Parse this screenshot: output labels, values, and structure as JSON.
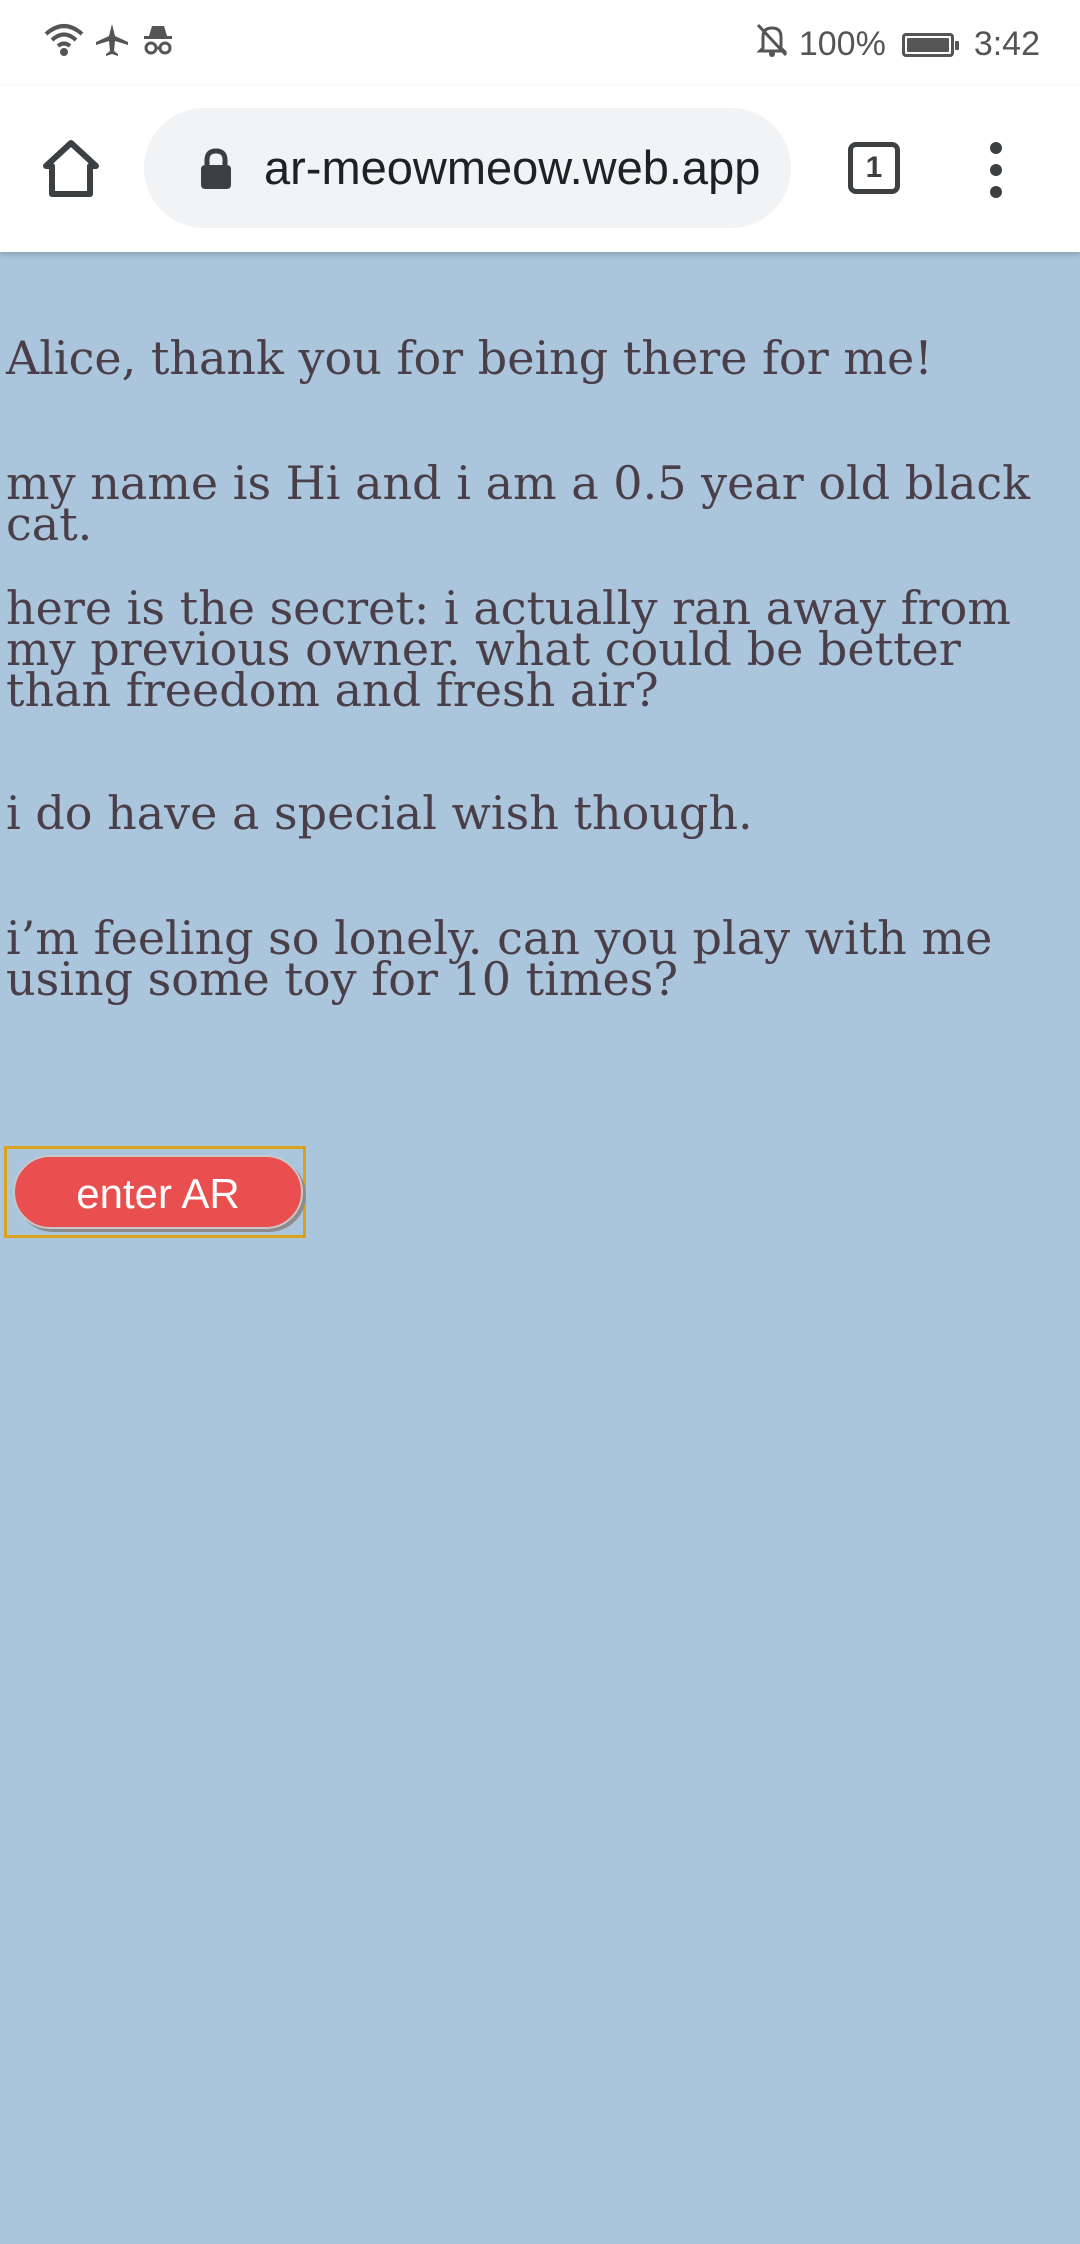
{
  "status_bar": {
    "battery_percent": "100%",
    "time": "3:42",
    "icons": [
      "wifi-icon",
      "airplane-icon",
      "incognito-icon",
      "notifications-off-icon",
      "battery-icon"
    ]
  },
  "browser": {
    "url": "ar-meowmeow.web.app",
    "tab_count": "1"
  },
  "page": {
    "background_color": "#abc6dc",
    "paragraphs": [
      "Alice, thank you for being there for me!",
      "my name is Hi and i am a 0.5 year old black cat.",
      "here is the secret: i actually ran away from my previous owner. what could be better than freedom and fresh air?",
      "i do have a special wish though.",
      "i’m feeling so lonely. can you play with me using some toy for 10 times?"
    ],
    "enter_ar_label": "enter AR"
  }
}
